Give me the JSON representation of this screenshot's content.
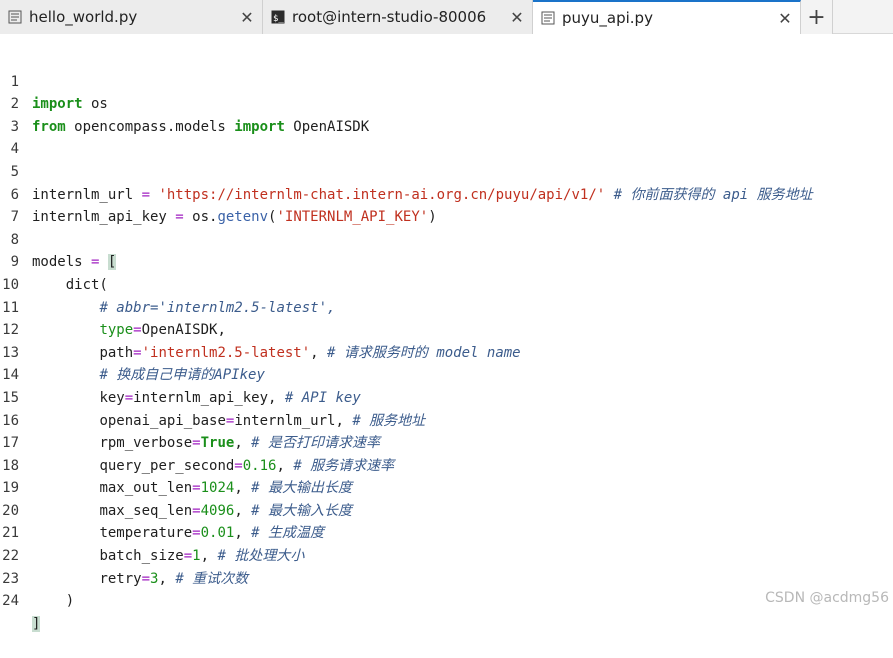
{
  "tabs": [
    {
      "label": "hello_world.py",
      "icon": "file-icon",
      "active": false
    },
    {
      "label": "root@intern-studio-80006",
      "icon": "terminal-icon",
      "active": false
    },
    {
      "label": "puyu_api.py",
      "icon": "file-icon",
      "active": true
    }
  ],
  "close_glyph": "✕",
  "add_tab_glyph": "+",
  "colors": {
    "keyword": "#1a8f1a",
    "string": "#c0301f",
    "comment": "#3c5c8c",
    "operator": "#a020c0",
    "active_tab_accent": "#1a73c9"
  },
  "code": {
    "line_numbers": [
      "1",
      "2",
      "3",
      "4",
      "5",
      "6",
      "7",
      "8",
      "9",
      "10",
      "11",
      "12",
      "13",
      "14",
      "15",
      "16",
      "17",
      "18",
      "19",
      "20",
      "21",
      "22",
      "23",
      "24"
    ],
    "l1": {
      "kw": "import",
      "rest": " os"
    },
    "l2": {
      "kw1": "from",
      "mod": " opencompass.models ",
      "kw2": "import",
      "rest": " OpenAISDK"
    },
    "l5": {
      "name": "internlm_url ",
      "op": "=",
      "sp": " ",
      "str": "'https://internlm-chat.intern-ai.org.cn/puyu/api/v1/'",
      "cm": " # 你前面获得的 api 服务地址"
    },
    "l6": {
      "name": "internlm_api_key ",
      "op": "=",
      "mid": " os.",
      "fn": "getenv",
      "open": "(",
      "str": "'INTERNLM_API_KEY'",
      "close": ")"
    },
    "l8": {
      "name": "models ",
      "op": "=",
      "sp": " ",
      "bracket": "["
    },
    "l9": {
      "text": "    dict("
    },
    "l10": {
      "indent": "        ",
      "cm": "# abbr='internlm2.5-latest',"
    },
    "l11": {
      "indent": "        ",
      "key": "type",
      "op": "=",
      "val": "OpenAISDK,"
    },
    "l12": {
      "indent": "        ",
      "key": "path",
      "op": "=",
      "str": "'internlm2.5-latest'",
      "sep": ", ",
      "cm": "# 请求服务时的 model name"
    },
    "l13": {
      "indent": "        ",
      "cm": "# 换成自己申请的APIkey"
    },
    "l14": {
      "indent": "        ",
      "key": "key",
      "op": "=",
      "val": "internlm_api_key, ",
      "cm": "# API key"
    },
    "l15": {
      "indent": "        ",
      "key": "openai_api_base",
      "op": "=",
      "val": "internlm_url, ",
      "cm": "# 服务地址"
    },
    "l16": {
      "indent": "        ",
      "key": "rpm_verbose",
      "op": "=",
      "bool": "True",
      "sep": ", ",
      "cm": "# 是否打印请求速率"
    },
    "l17": {
      "indent": "        ",
      "key": "query_per_second",
      "op": "=",
      "num": "0.16",
      "sep": ", ",
      "cm": "# 服务请求速率"
    },
    "l18": {
      "indent": "        ",
      "key": "max_out_len",
      "op": "=",
      "num": "1024",
      "sep": ", ",
      "cm": "# 最大输出长度"
    },
    "l19": {
      "indent": "        ",
      "key": "max_seq_len",
      "op": "=",
      "num": "4096",
      "sep": ", ",
      "cm": "# 最大输入长度"
    },
    "l20": {
      "indent": "        ",
      "key": "temperature",
      "op": "=",
      "num": "0.01",
      "sep": ", ",
      "cm": "# 生成温度"
    },
    "l21": {
      "indent": "        ",
      "key": "batch_size",
      "op": "=",
      "num": "1",
      "sep": ", ",
      "cm": "# 批处理大小"
    },
    "l22": {
      "indent": "        ",
      "key": "retry",
      "op": "=",
      "num": "3",
      "sep": ", ",
      "cm": "# 重试次数"
    },
    "l23": {
      "text": "    )"
    },
    "l24": {
      "bracket": "]"
    }
  },
  "watermark": "CSDN @acdmg56"
}
